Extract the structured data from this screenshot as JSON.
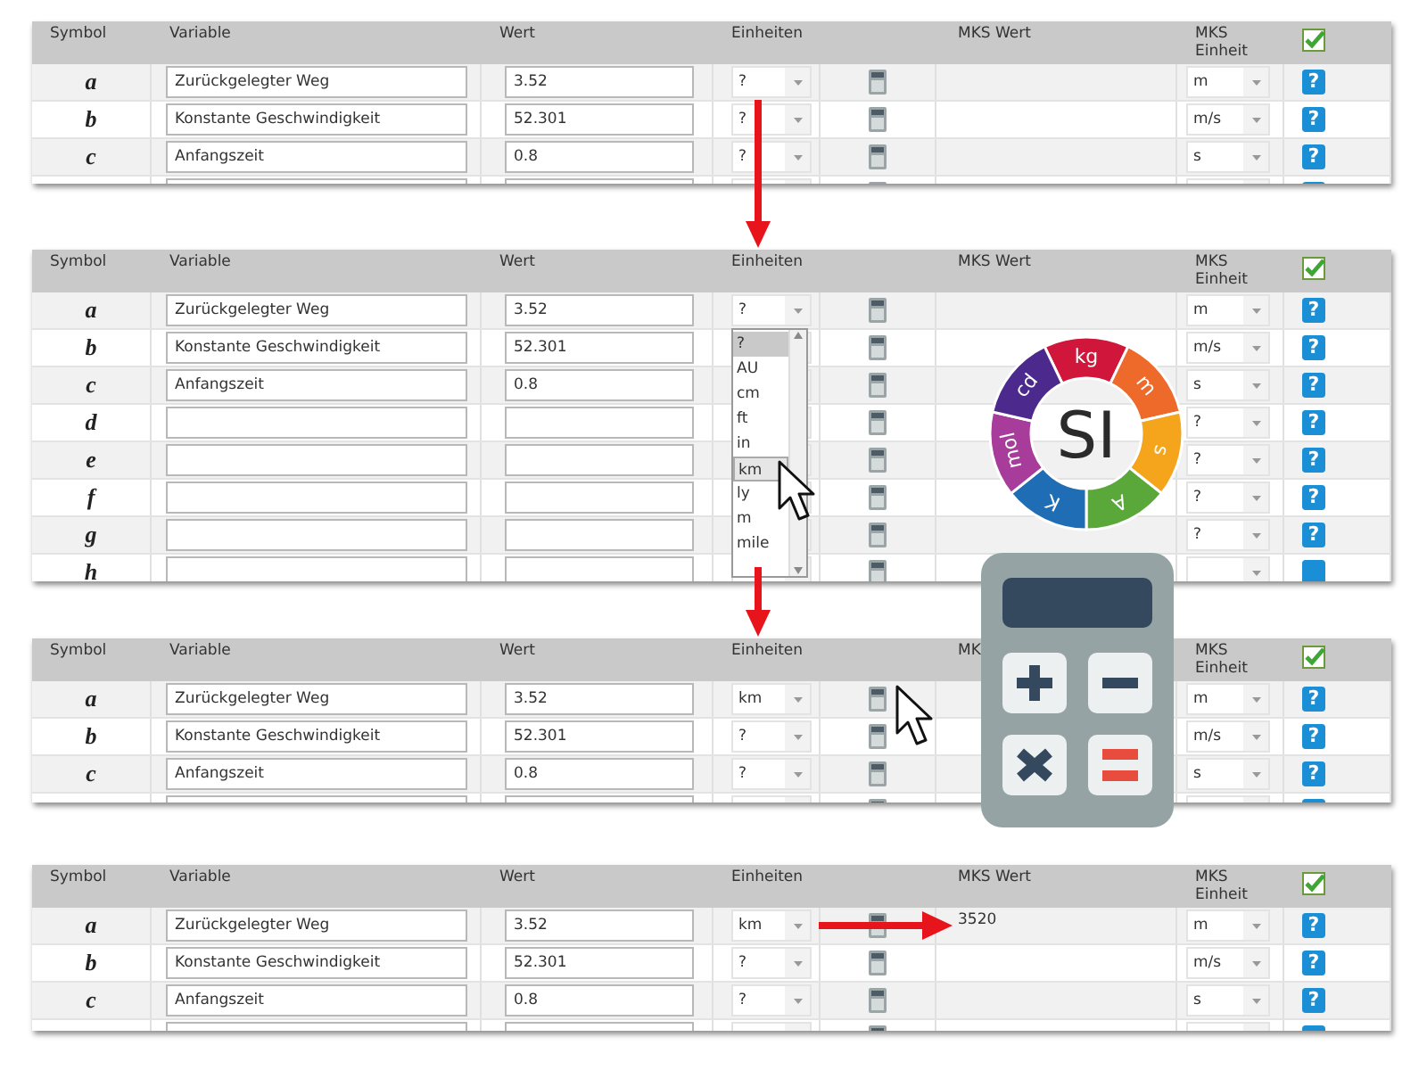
{
  "panels": [
    {
      "columns": [
        "Symbol",
        "Variable",
        "Wert",
        "Einheiten",
        "MKS Wert",
        "MKS Einheit"
      ],
      "header_checkbox": {
        "checked": true
      },
      "rows": [
        {
          "symbol": "a",
          "variable": "Zurückgelegter Weg",
          "wert": "3.52",
          "einheit": "?",
          "mks_einheit": "m",
          "help": "?"
        },
        {
          "symbol": "b",
          "variable": "Konstante Geschwindigkeit",
          "wert": "52.301",
          "einheit": "?",
          "mks_einheit": "m/s",
          "help": "?"
        },
        {
          "symbol": "c",
          "variable": "Anfangszeit",
          "wert": "0.8",
          "einheit": "?",
          "mks_einheit": "s",
          "help": "?"
        },
        {}
      ]
    },
    {
      "columns": [
        "Symbol",
        "Variable",
        "Wert",
        "Einheiten",
        "MKS Wert",
        "MKS Einheit"
      ],
      "header_checkbox": {
        "checked": true
      },
      "rows": [
        {
          "symbol": "a",
          "variable": "Zurückgelegter Weg",
          "wert": "3.52",
          "einheit": "?",
          "mks_einheit": "m",
          "help": "?"
        },
        {
          "symbol": "b",
          "variable": "Konstante Geschwindigkeit",
          "wert": "52.301",
          "mks_einheit": "m/s",
          "help": "?"
        },
        {
          "symbol": "c",
          "variable": "Anfangszeit",
          "wert": "0.8",
          "mks_einheit": "s",
          "help": "?"
        },
        {
          "symbol": "d",
          "mks_einheit": "?",
          "help": "?"
        },
        {
          "symbol": "e",
          "mks_einheit": "?",
          "help": "?"
        },
        {
          "symbol": "f",
          "mks_einheit": "?",
          "help": "?"
        },
        {
          "symbol": "g",
          "mks_einheit": "?",
          "help": "?"
        },
        {
          "symbol": "h"
        }
      ],
      "dropdown": {
        "options": [
          {
            "label": "?",
            "selected": true,
            "hovered": false
          },
          {
            "label": "AU",
            "selected": false,
            "hovered": false
          },
          {
            "label": "cm",
            "selected": false,
            "hovered": false
          },
          {
            "label": "ft",
            "selected": false,
            "hovered": false
          },
          {
            "label": "in",
            "selected": false,
            "hovered": false
          },
          {
            "label": "km",
            "selected": false,
            "hovered": true
          },
          {
            "label": "ly",
            "selected": false,
            "hovered": false
          },
          {
            "label": "m",
            "selected": false,
            "hovered": false
          },
          {
            "label": "mile",
            "selected": false,
            "hovered": false
          }
        ]
      }
    },
    {
      "columns": [
        "Symbol",
        "Variable",
        "Wert",
        "Einheiten",
        "MK",
        "MKS Einheit"
      ],
      "header_checkbox": {
        "checked": true
      },
      "rows": [
        {
          "symbol": "a",
          "variable": "Zurückgelegter Weg",
          "wert": "3.52",
          "einheit": "km",
          "mks_einheit": "m",
          "help": "?"
        },
        {
          "symbol": "b",
          "variable": "Konstante Geschwindigkeit",
          "wert": "52.301",
          "einheit": "?",
          "mks_einheit": "m/s",
          "help": "?"
        },
        {
          "symbol": "c",
          "variable": "Anfangszeit",
          "wert": "0.8",
          "einheit": "?",
          "mks_einheit": "s",
          "help": "?"
        },
        {}
      ]
    },
    {
      "columns": [
        "Symbol",
        "Variable",
        "Wert",
        "Einheiten",
        "MKS Wert",
        "MKS Einheit"
      ],
      "header_checkbox": {
        "checked": true
      },
      "rows": [
        {
          "symbol": "a",
          "variable": "Zurückgelegter Weg",
          "wert": "3.52",
          "einheit": "km",
          "mks_wert": "3520",
          "mks_einheit": "m",
          "help": "?"
        },
        {
          "symbol": "b",
          "variable": "Konstante Geschwindigkeit",
          "wert": "52.301",
          "einheit": "?",
          "mks_einheit": "m/s",
          "help": "?"
        },
        {
          "symbol": "c",
          "variable": "Anfangszeit",
          "wert": "0.8",
          "einheit": "?",
          "mks_einheit": "s",
          "help": "?"
        },
        {}
      ]
    }
  ],
  "si_logo": {
    "center": "SI",
    "segments": [
      {
        "label": "kg",
        "color": "#d0173b"
      },
      {
        "label": "m",
        "color": "#ee6a2b"
      },
      {
        "label": "s",
        "color": "#f5a51c"
      },
      {
        "label": "A",
        "color": "#5aa83a"
      },
      {
        "label": "K",
        "color": "#1f6db5"
      },
      {
        "label": "mol",
        "color": "#a73c9a"
      },
      {
        "label": "cd",
        "color": "#4c2a8d"
      }
    ]
  }
}
